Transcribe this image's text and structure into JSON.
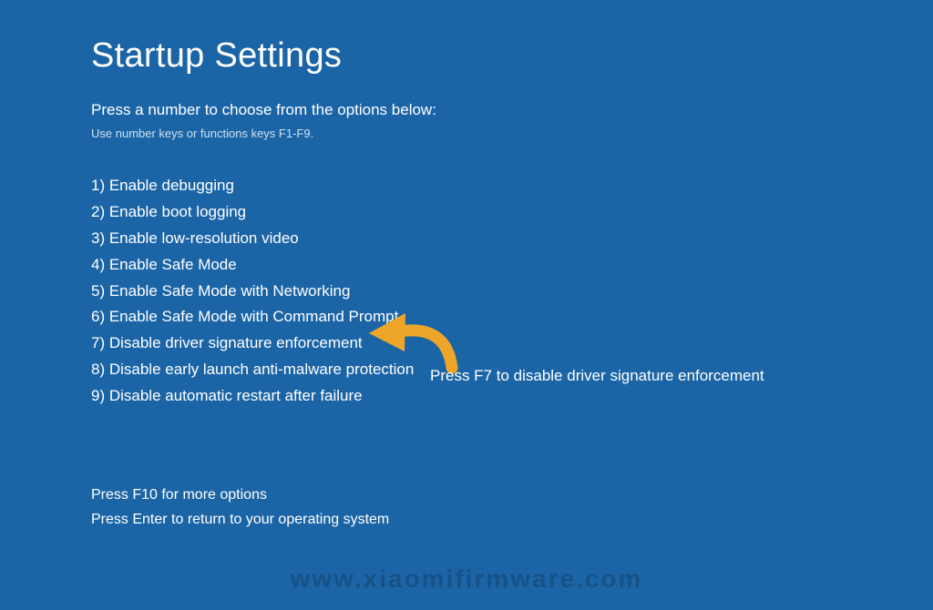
{
  "title": "Startup Settings",
  "instruction": "Press a number to choose from the options below:",
  "hint": "Use number keys or functions keys F1-F9.",
  "options": [
    "1) Enable debugging",
    "2) Enable boot logging",
    "3) Enable low-resolution video",
    "4) Enable Safe Mode",
    "5) Enable Safe Mode with Networking",
    "6) Enable Safe Mode with Command Prompt",
    "7) Disable driver signature enforcement",
    "8) Disable early launch anti-malware protection",
    "9) Disable automatic restart after failure"
  ],
  "footer": {
    "more": "Press F10 for more options",
    "return": "Press Enter to return to your operating system"
  },
  "callout": "Press F7 to disable driver signature enforcement",
  "watermark": "www.xiaomifirmware.com",
  "arrow_color": "#eea628"
}
